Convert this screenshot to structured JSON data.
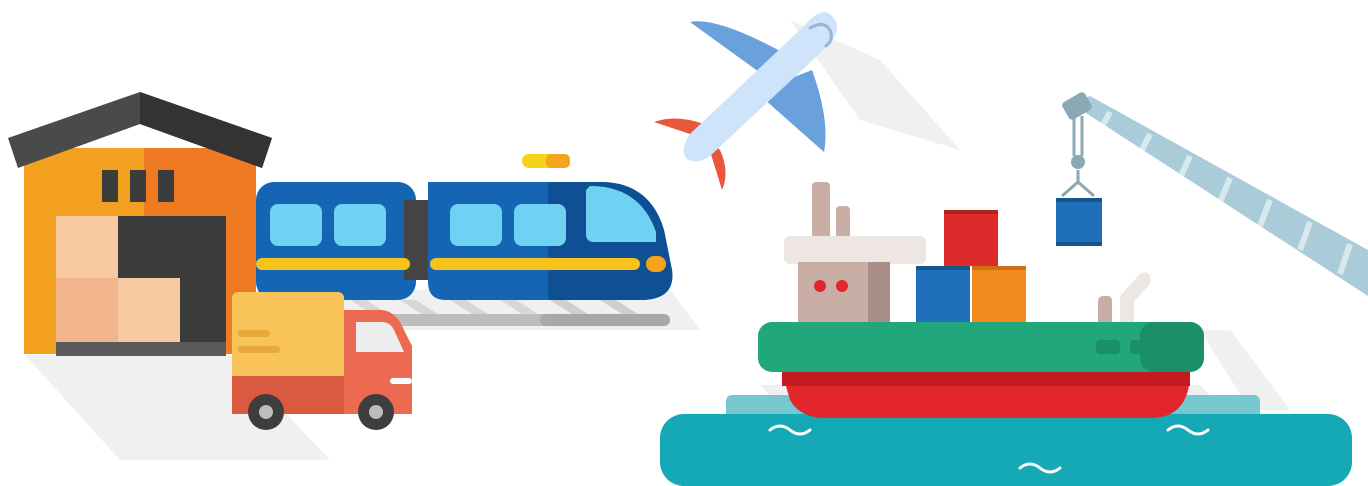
{
  "illustration": {
    "items": [
      {
        "key": "warehouse",
        "icon": "warehouse-icon"
      },
      {
        "key": "train",
        "icon": "train-icon"
      },
      {
        "key": "truck",
        "icon": "delivery-truck-icon"
      },
      {
        "key": "airplane",
        "icon": "airplane-icon"
      },
      {
        "key": "cargo_ship",
        "icon": "cargo-ship-icon"
      },
      {
        "key": "crane",
        "icon": "harbor-crane-icon"
      },
      {
        "key": "sea",
        "icon": "sea-water-icon"
      }
    ]
  },
  "colors": {
    "warehouse_roof": "#3f3f3f",
    "warehouse_wall_light": "#f4a020",
    "warehouse_wall_dark": "#ee7a22",
    "train_body": "#1565b5",
    "train_window": "#6fd2f2",
    "train_stripe": "#f6c21b",
    "truck_cab": "#ec6a51",
    "truck_cargo": "#f8c45a",
    "plane_body": "#cfe4fa",
    "plane_wing": "#6aa0dc",
    "plane_tail": "#e8573c",
    "ship_deck": "#22a77c",
    "ship_hull": "#e3252c",
    "container_red": "#dd2b2b",
    "container_blue": "#1f6fbb",
    "container_orange": "#f28a1e",
    "sea": "#14a9b4",
    "sea_light": "#76c7cf",
    "shadow": "#eeeeee"
  }
}
